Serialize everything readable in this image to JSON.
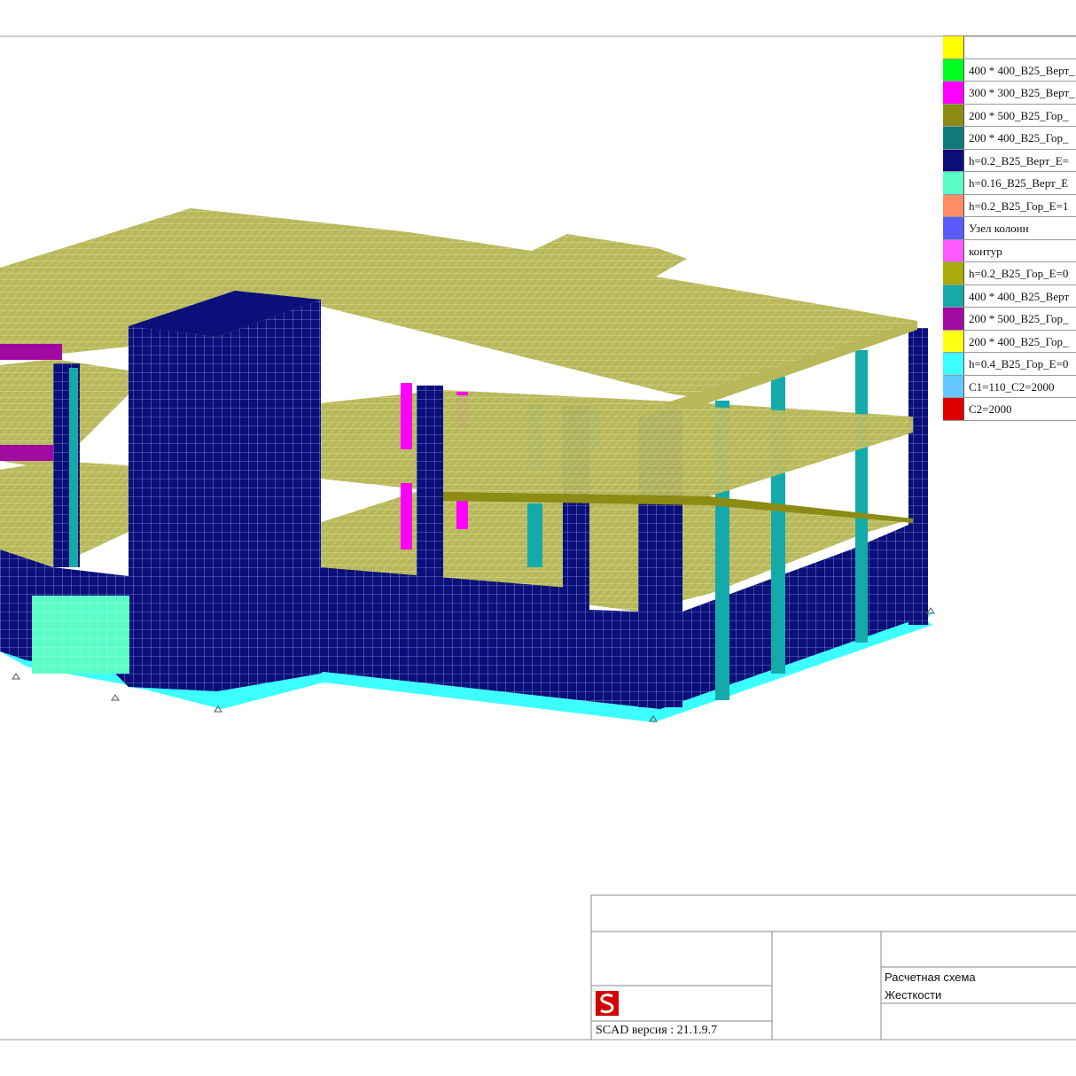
{
  "legend": {
    "items": [
      {
        "color": "#ffff00",
        "label": ""
      },
      {
        "color": "#00ff1e",
        "label": "400 * 400_B25_Верт_"
      },
      {
        "color": "#ff00ff",
        "label": "300 * 300_B25_Верт_"
      },
      {
        "color": "#8c8c14",
        "label": "200 * 500_B25_Гор_"
      },
      {
        "color": "#0f7a7a",
        "label": "200 * 400_B25_Гор_"
      },
      {
        "color": "#0a0f7a",
        "label": "h=0.2_B25_Верт_E="
      },
      {
        "color": "#5affc8",
        "label": "h=0.16_B25_Верт_E"
      },
      {
        "color": "#ff8c64",
        "label": "h=0.2_B25_Гор_E=1"
      },
      {
        "color": "#5a5aff",
        "label": "Узел колонн"
      },
      {
        "color": "#ff5aff",
        "label": "контур"
      },
      {
        "color": "#aaaa0a",
        "label": "h=0.2_B25_Гор_E=0"
      },
      {
        "color": "#14aaaa",
        "label": "400 * 400_B25_Верт"
      },
      {
        "color": "#a00aa0",
        "label": "200 * 500_B25_Гор_"
      },
      {
        "color": "#ffff14",
        "label": "200 * 400_B25_Гор_"
      },
      {
        "color": "#3cffff",
        "label": "h=0.4_B25_Гор_E=0"
      },
      {
        "color": "#64c8ff",
        "label": "C1=110_C2=2000"
      },
      {
        "color": "#dc0000",
        "label": "C2=2000"
      }
    ]
  },
  "title_block": {
    "title_line1": "Расчетная схема",
    "title_line2": "Жесткости",
    "version": "SCAD версия : 21.1.9.7",
    "logo_icon": "scad-logo-icon",
    "logo_color": "#d40000"
  },
  "model_colors": {
    "slab": "#b8b85a",
    "wall": "#0a0f7a",
    "column_teal": "#14aaaa",
    "column_magenta": "#ff00ff",
    "beam_purple": "#a00aa0",
    "foundation": "#3cffff",
    "panel_mint": "#5affc8",
    "mesh_line": "#ffffff"
  }
}
